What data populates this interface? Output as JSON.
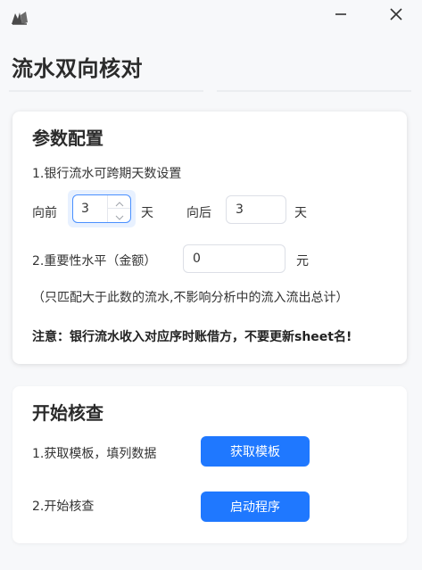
{
  "window": {
    "app_icon": "app-logo-icon",
    "minimize_icon": "minimize-icon",
    "close_icon": "close-icon"
  },
  "page": {
    "title": "流水双向核对"
  },
  "params": {
    "title": "参数配置",
    "cross_days_label": "1.银行流水可跨期天数设置",
    "forward_label": "向前",
    "forward_value": "3",
    "forward_unit": "天",
    "backward_label": "向后",
    "backward_value": "3",
    "backward_unit": "天",
    "importance_label": "2.重要性水平（金额）",
    "importance_value": "0",
    "importance_unit": "元",
    "hint": "（只匹配大于此数的流水,不影响分析中的流入流出总计）",
    "notice": "注意：银行流水收入对应序时账借方，不要更新sheet名!"
  },
  "check": {
    "title": "开始核查",
    "step1_label": "1.获取模板，填列数据",
    "step1_button": "获取模板",
    "step2_label": "2.开始核查",
    "step2_button": "启动程序"
  },
  "colors": {
    "accent": "#1f78ff",
    "background": "#f7f8fa"
  }
}
